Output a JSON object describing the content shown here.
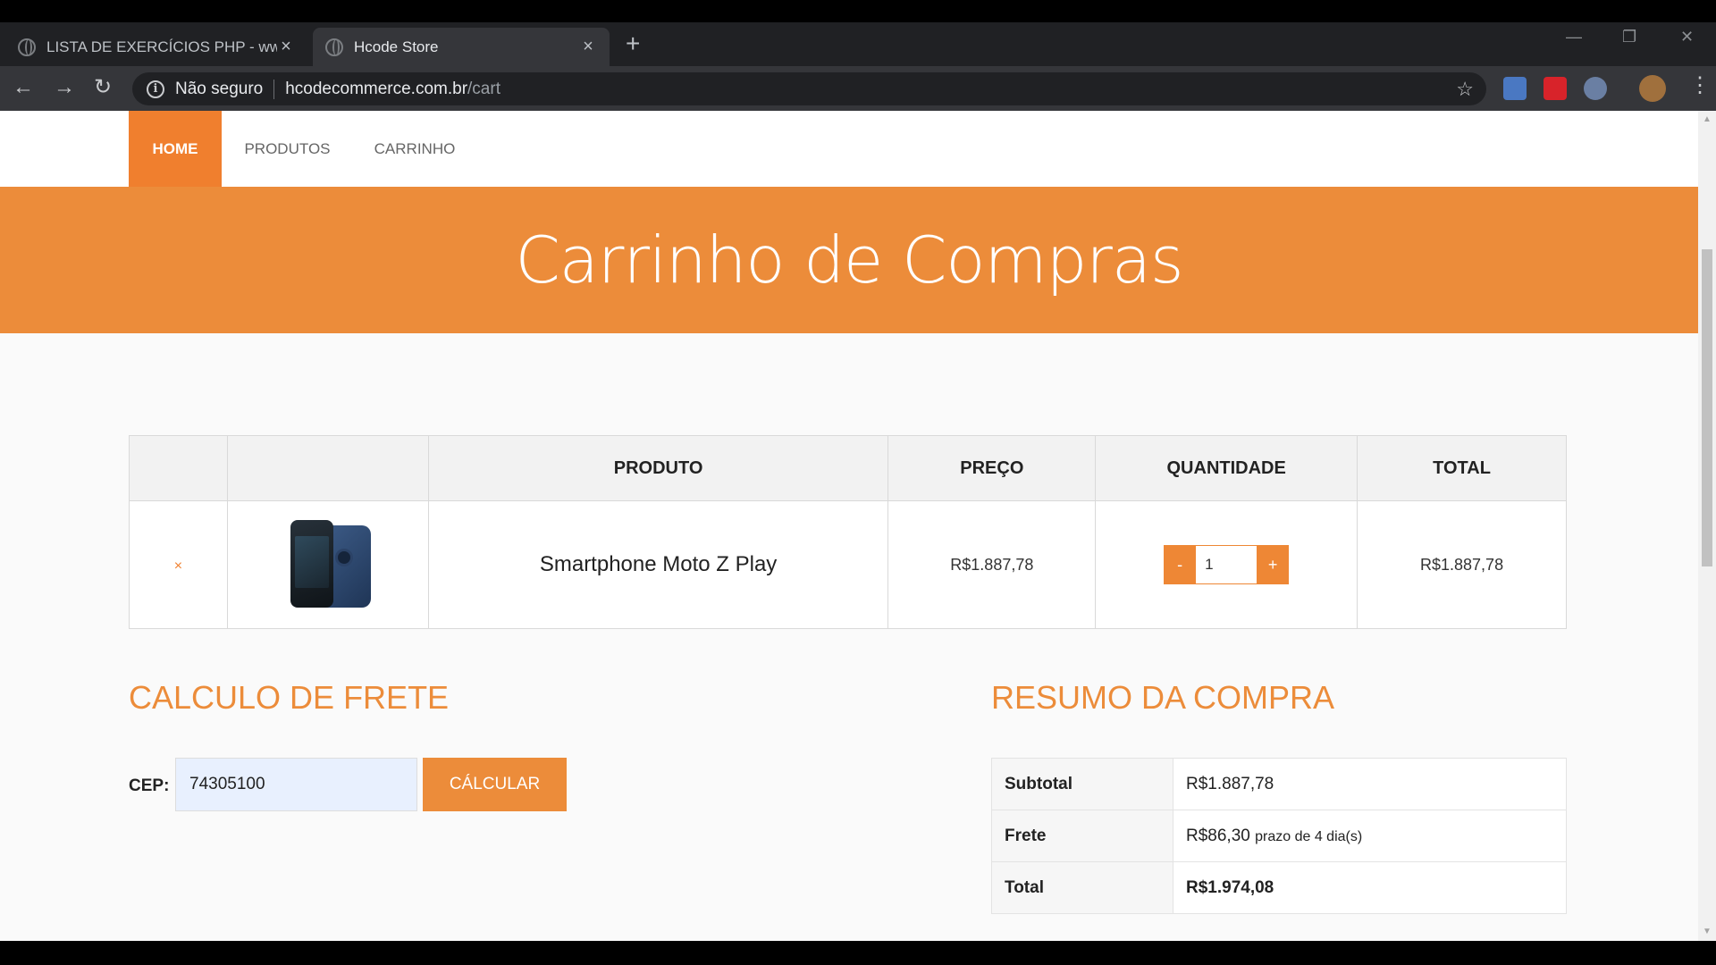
{
  "browser": {
    "tabs": [
      {
        "title": "LISTA DE EXERCÍCIOS PHP - www.",
        "active": false
      },
      {
        "title": "Hcode Store",
        "active": true
      }
    ],
    "security_text": "Não seguro",
    "url_host": "hcodecommerce.com.br",
    "url_path": "/cart"
  },
  "nav": {
    "items": [
      {
        "label": "HOME",
        "active": true
      },
      {
        "label": "PRODUTOS",
        "active": false
      },
      {
        "label": "CARRINHO",
        "active": false
      }
    ]
  },
  "banner": {
    "title": "Carrinho de Compras"
  },
  "cart": {
    "headers": [
      "",
      "",
      "PRODUTO",
      "PREÇO",
      "QUANTIDADE",
      "TOTAL"
    ],
    "items": [
      {
        "remove_label": "×",
        "image_icon": "smartphone-image",
        "name": "Smartphone Moto Z Play",
        "price": "R$1.887,78",
        "quantity": "1",
        "minus_label": "-",
        "plus_label": "+",
        "total": "R$1.887,78"
      }
    ]
  },
  "shipping": {
    "title": "CALCULO DE FRETE",
    "cep_label": "CEP:",
    "cep_value": "74305100",
    "button_label": "CÁLCULAR"
  },
  "summary": {
    "title": "RESUMO DA COMPRA",
    "rows": [
      {
        "label": "Subtotal",
        "value": "R$1.887,78",
        "note": ""
      },
      {
        "label": "Frete",
        "value": "R$86,30",
        "note": "prazo de 4 dia(s)"
      },
      {
        "label": "Total",
        "value": "R$1.974,08",
        "note": ""
      }
    ]
  },
  "colors": {
    "accent": "#ec8c3a",
    "nav_active": "#f07f2e"
  }
}
